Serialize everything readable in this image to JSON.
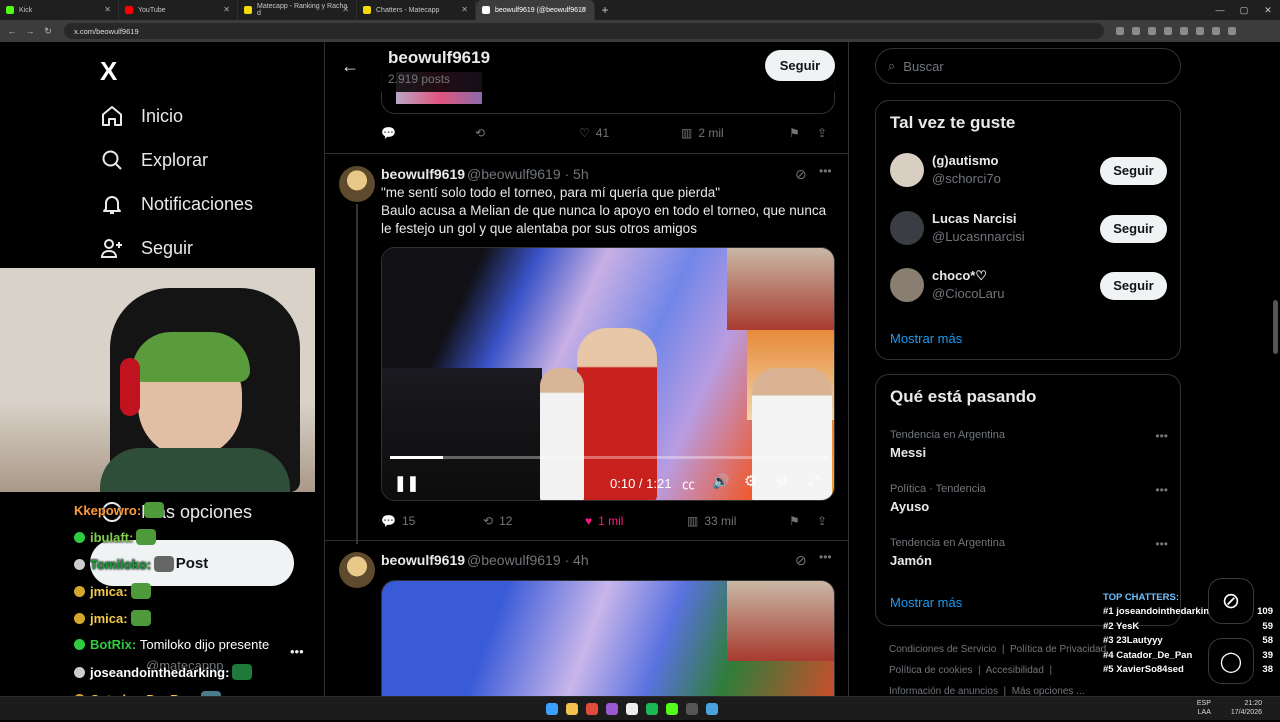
{
  "browser": {
    "tabs": [
      {
        "label": "Kick",
        "color": "#53fc18"
      },
      {
        "label": "YouTube",
        "color": "#ff0000"
      },
      {
        "label": "Matecapp - Ranking y Racha d",
        "color": "#f5d90a"
      },
      {
        "label": "Chatters - Matecapp",
        "color": "#f5d90a"
      },
      {
        "label": "beowulf9619 (@beowulf9619",
        "color": "#ffffff"
      }
    ],
    "url": "x.com/beowulf9619"
  },
  "sidebar": {
    "logo": "X",
    "items": [
      {
        "label": "Inicio",
        "icon": "home-icon"
      },
      {
        "label": "Explorar",
        "icon": "search-icon"
      },
      {
        "label": "Notificaciones",
        "icon": "bell-icon"
      },
      {
        "label": "Seguir",
        "icon": "person-add-icon"
      }
    ],
    "more_label": "Más opciones",
    "post_label": "Post",
    "account_handle": "@matecappp"
  },
  "profile": {
    "name": "beowulf9619",
    "posts": "2.919 posts",
    "follow_label": "Seguir"
  },
  "tweets": [
    {
      "stats": {
        "replies": "",
        "retweets": "",
        "likes": "41",
        "views": "2 mil"
      }
    },
    {
      "name": "beowulf9619",
      "meta": "@beowulf9619 · 5h",
      "line1": "\"me sentí solo todo el torneo, para mí quería que pierda\"",
      "line2": "Baulo acusa a Melian de que nunca lo apoyo en todo el torneo, que nunca le festejo un gol y que alentaba por sus otros amigos",
      "video_time": "0:10 / 1:21",
      "video_progress": 0.12,
      "stats": {
        "replies": "15",
        "retweets": "12",
        "likes": "1 mil",
        "views": "33 mil"
      }
    },
    {
      "name": "beowulf9619",
      "meta": "@beowulf9619 · 4h"
    }
  ],
  "right": {
    "search_placeholder": "Buscar",
    "suggest_title": "Tal vez te guste",
    "suggestions": [
      {
        "name": "(g)autismo",
        "handle": "@schorci7o",
        "button": "Seguir"
      },
      {
        "name": "Lucas Narcisi",
        "handle": "@Lucasnnarcisi",
        "button": "Seguir"
      },
      {
        "name": "choco*♡",
        "handle": "@CiocoLaru",
        "button": "Seguir"
      }
    ],
    "show_more": "Mostrar más",
    "trends_title": "Qué está pasando",
    "trends": [
      {
        "context": "Tendencia en Argentina",
        "topic": "Messi"
      },
      {
        "context": "Política · Tendencia",
        "topic": "Ayuso"
      },
      {
        "context": "Tendencia en Argentina",
        "topic": "Jamón"
      }
    ],
    "trends_more": "Mostrar más",
    "footer": [
      "Condiciones de Servicio",
      "Política de Privacidad",
      "Política de cookies",
      "Accesibilidad",
      "Información de anuncios",
      "Más opciones ..."
    ]
  },
  "chat": [
    {
      "user": "Kkepowro:",
      "color": "#ff9a3c",
      "msg": ""
    },
    {
      "user": "ibulaft:",
      "color": "#7fd14a",
      "msg": ""
    },
    {
      "user": "Tomiloko:",
      "color": "#1a9a3a",
      "msg": ""
    },
    {
      "user": "jmica:",
      "color": "#f2c94c",
      "msg": ""
    },
    {
      "user": "jmica:",
      "color": "#f2c94c",
      "msg": ""
    },
    {
      "user": "BotRix:",
      "color": "#2ecc40",
      "msg": "Tomiloko dijo presente"
    },
    {
      "user": "joseandointhedarking:",
      "color": "#ffffff",
      "msg": ""
    },
    {
      "user": "Catador_De_Pan:",
      "color": "#f2c94c",
      "msg": ""
    }
  ],
  "top_chatters": {
    "title": "TOP CHATTERS:",
    "rows": [
      {
        "rank": "#1",
        "name": "joseandointhedarking",
        "count": "109"
      },
      {
        "rank": "#2",
        "name": "YesK",
        "count": "59"
      },
      {
        "rank": "#3",
        "name": "23Lautyyy",
        "count": "58"
      },
      {
        "rank": "#4",
        "name": "Catador_De_Pan",
        "count": "39"
      },
      {
        "rank": "#5",
        "name": "XavierSo84sed",
        "count": "38"
      }
    ]
  },
  "taskbar": {
    "lang": "ESP",
    "lang2": "LAA",
    "time": "21:20",
    "date": "17/4/2026"
  }
}
